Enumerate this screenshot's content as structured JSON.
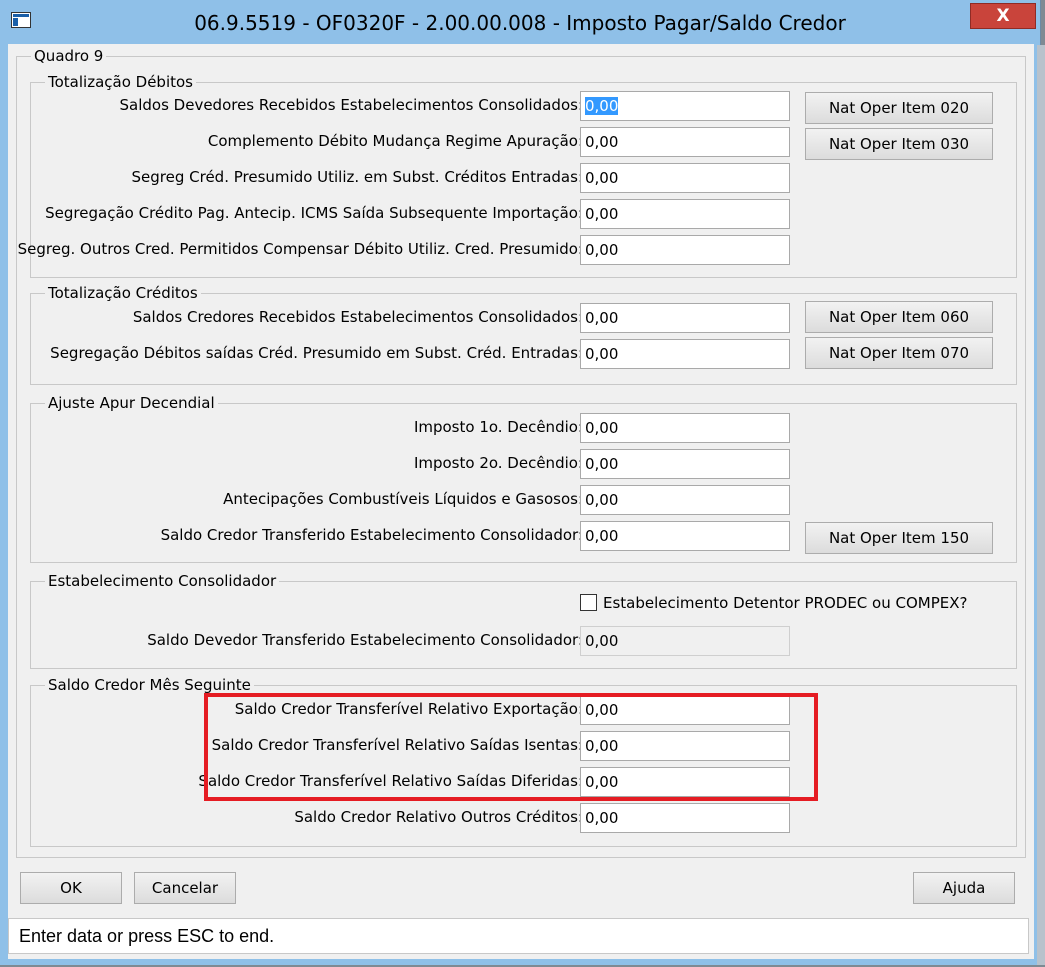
{
  "window": {
    "title": "06.9.5519 - OF0320F - 2.00.00.008 - Imposto Pagar/Saldo Credor",
    "close_label": "X"
  },
  "quadro": {
    "legend": "Quadro 9"
  },
  "debitos": {
    "legend": "Totalização Débitos",
    "fields": [
      {
        "label": "Saldos Devedores Recebidos Estabelecimentos Consolidados:",
        "value": "0,00"
      },
      {
        "label": "Complemento Débito Mudança Regime Apuração:",
        "value": "0,00"
      },
      {
        "label": "Segreg Créd. Presumido Utiliz. em Subst. Créditos Entradas:",
        "value": "0,00"
      },
      {
        "label": "Segregação Crédito Pag. Antecip. ICMS Saída Subsequente Importação:",
        "value": "0,00"
      },
      {
        "label": "Segreg. Outros Cred. Permitidos Compensar Débito Utiliz. Cred. Presumido:",
        "value": "0,00"
      }
    ],
    "buttons": [
      "Nat Oper Item 020",
      "Nat Oper Item 030"
    ]
  },
  "creditos": {
    "legend": "Totalização Créditos",
    "fields": [
      {
        "label": "Saldos Credores Recebidos Estabelecimentos Consolidados:",
        "value": "0,00"
      },
      {
        "label": "Segregação Débitos saídas Créd. Presumido em Subst. Créd. Entradas:",
        "value": "0,00"
      }
    ],
    "buttons": [
      "Nat Oper Item 060",
      "Nat Oper Item 070"
    ]
  },
  "decendial": {
    "legend": "Ajuste Apur Decendial",
    "fields": [
      {
        "label": "Imposto 1o. Decêndio:",
        "value": "0,00"
      },
      {
        "label": "Imposto 2o. Decêndio:",
        "value": "0,00"
      },
      {
        "label": "Antecipações Combustíveis Líquidos e Gasosos:",
        "value": "0,00"
      },
      {
        "label": "Saldo Credor Transferido Estabelecimento Consolidador:",
        "value": "0,00"
      }
    ],
    "buttons": [
      "Nat Oper Item 150"
    ]
  },
  "consolidador": {
    "legend": "Estabelecimento Consolidador",
    "checkbox_label": "Estabelecimento Detentor PRODEC ou COMPEX?",
    "checkbox_checked": false,
    "field": {
      "label": "Saldo Devedor Transferido Estabelecimento Consolidador:",
      "value": "0,00"
    }
  },
  "saldo_credor": {
    "legend": "Saldo Credor Mês Seguinte",
    "fields": [
      {
        "label": "Saldo Credor Transferível Relativo Exportação:",
        "value": "0,00"
      },
      {
        "label": "Saldo Credor Transferível Relativo Saídas Isentas:",
        "value": "0,00"
      },
      {
        "label": "Saldo Credor Transferível Relativo Saídas Diferidas:",
        "value": "0,00"
      },
      {
        "label": "Saldo Credor Relativo Outros Créditos:",
        "value": "0,00"
      }
    ]
  },
  "footer": {
    "ok_label": "OK",
    "cancel_label": "Cancelar",
    "help_label": "Ajuda"
  },
  "status": {
    "text": "Enter data or press ESC to end."
  },
  "colors": {
    "titlebar": "#8fc0e8",
    "close": "#c9443b",
    "highlight": "#e51c23",
    "selection": "#3399ff"
  }
}
